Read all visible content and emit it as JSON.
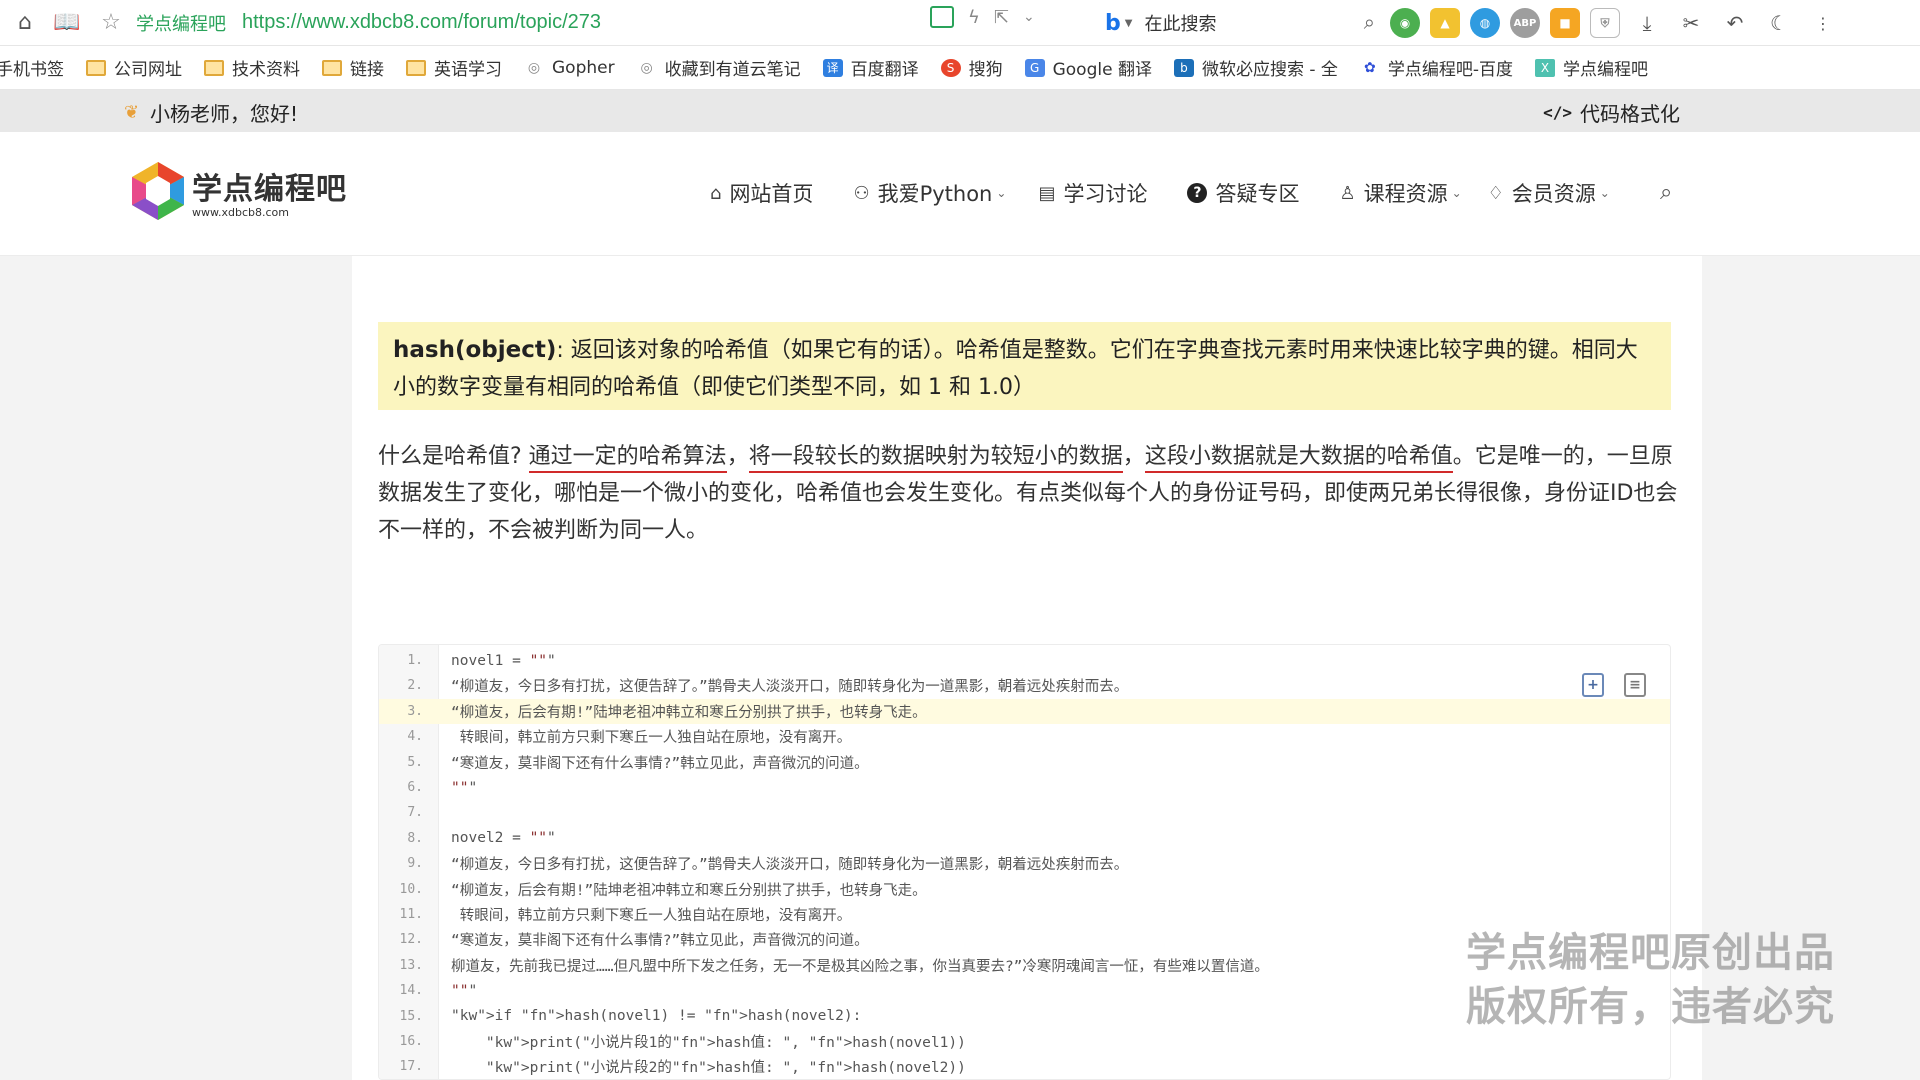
{
  "browser": {
    "site_name": "学点编程吧",
    "url": "https://www.xdbcb8.com/forum/topic/273",
    "search_placeholder": "在此搜索"
  },
  "bookmarks": [
    {
      "label": "手机书签",
      "icon": "none"
    },
    {
      "label": "公司网址",
      "icon": "folder"
    },
    {
      "label": "技术资料",
      "icon": "folder"
    },
    {
      "label": "链接",
      "icon": "folder"
    },
    {
      "label": "英语学习",
      "icon": "folder"
    },
    {
      "label": "Gopher",
      "icon": "globe"
    },
    {
      "label": "收藏到有道云笔记",
      "icon": "globe"
    },
    {
      "label": "百度翻译",
      "icon": "translate"
    },
    {
      "label": "搜狗",
      "icon": "sogou"
    },
    {
      "label": "Google 翻译",
      "icon": "google-translate"
    },
    {
      "label": "微软必应搜索 - 全",
      "icon": "bing"
    },
    {
      "label": "学点编程吧-百度",
      "icon": "baidu"
    },
    {
      "label": "学点编程吧",
      "icon": "site"
    }
  ],
  "site_top": {
    "greeting": "小杨老师，您好!",
    "code_format": "代码格式化"
  },
  "logo": {
    "name": "学点编程吧",
    "domain": "www.xdbcb8.com"
  },
  "nav": [
    {
      "label": "网站首页",
      "icon": "home-icon",
      "dropdown": false
    },
    {
      "label": "我爱Python",
      "icon": "python-icon",
      "dropdown": true
    },
    {
      "label": "学习讨论",
      "icon": "chat-icon",
      "dropdown": false
    },
    {
      "label": "答疑专区",
      "icon": "question-icon",
      "dropdown": false
    },
    {
      "label": "课程资源",
      "icon": "course-icon",
      "dropdown": true
    },
    {
      "label": "会员资源",
      "icon": "diamond-icon",
      "dropdown": true
    }
  ],
  "article": {
    "highlight_term": "hash(object)",
    "highlight_text": ": 返回该对象的哈希值（如果它有的话）。哈希值是整数。它们在字典查找元素时用来快速比较字典的键。相同大小的数字变量有相同的哈希值（即使它们类型不同，如 1 和 1.0）",
    "para_a": "什么是哈希值? ",
    "para_u1": "通过一定的哈希算法",
    "para_b": "，",
    "para_u2": "将一段较长的数据映射为较短小的数据",
    "para_c": "，",
    "para_u3": "这段小数据就是大数据的哈希值",
    "para_d": "。它是唯一的，一旦原数据发生了变化，哪怕是一个微小的变化，哈希值也会发生变化。有点类似每个人的身份证号码，即使两兄弟长得很像，身份证ID也会不一样的，不会被判断为同一人。"
  },
  "code": {
    "lines": [
      {
        "n": "1.",
        "text": "novel1 = \"\"\""
      },
      {
        "n": "2.",
        "text": "“柳道友，今日多有打扰，这便告辞了。”鹊骨夫人淡淡开口，随即转身化为一道黑影，朝着远处疾射而去。"
      },
      {
        "n": "3.",
        "text": "“柳道友，后会有期!”陆坤老祖冲韩立和寒丘分别拱了拱手，也转身飞走。"
      },
      {
        "n": "4.",
        "text": " 转眼间，韩立前方只剩下寒丘一人独自站在原地，没有离开。"
      },
      {
        "n": "5.",
        "text": "“寒道友，莫非阁下还有什么事情?”韩立见此，声音微沉的问道。"
      },
      {
        "n": "6.",
        "text": "\"\"\""
      },
      {
        "n": "7.",
        "text": ""
      },
      {
        "n": "8.",
        "text": "novel2 = \"\"\""
      },
      {
        "n": "9.",
        "text": "“柳道友，今日多有打扰，这便告辞了。”鹊骨夫人淡淡开口，随即转身化为一道黑影，朝着远处疾射而去。"
      },
      {
        "n": "10.",
        "text": "“柳道友，后会有期!”陆坤老祖冲韩立和寒丘分别拱了拱手，也转身飞走。"
      },
      {
        "n": "11.",
        "text": " 转眼间，韩立前方只剩下寒丘一人独自站在原地，没有离开。"
      },
      {
        "n": "12.",
        "text": "“寒道友，莫非阁下还有什么事情?”韩立见此，声音微沉的问道。"
      },
      {
        "n": "13.",
        "text": "柳道友，先前我已提过……但凡盟中所下发之任务，无一不是极其凶险之事，你当真要去?”冷寒阴魂闻言一怔，有些难以置信道。"
      },
      {
        "n": "14.",
        "text": "\"\"\""
      },
      {
        "n": "15.",
        "text": "if hash(novel1) != hash(novel2):"
      },
      {
        "n": "16.",
        "text": "    print(\"小说片段1的hash值: \", hash(novel1))"
      },
      {
        "n": "17.",
        "text": "    print(\"小说片段2的hash值: \", hash(novel2))"
      }
    ],
    "highlighted_line": 3
  },
  "watermark": {
    "line1": "学点编程吧原创出品",
    "line2": "版权所有，违者必究"
  }
}
